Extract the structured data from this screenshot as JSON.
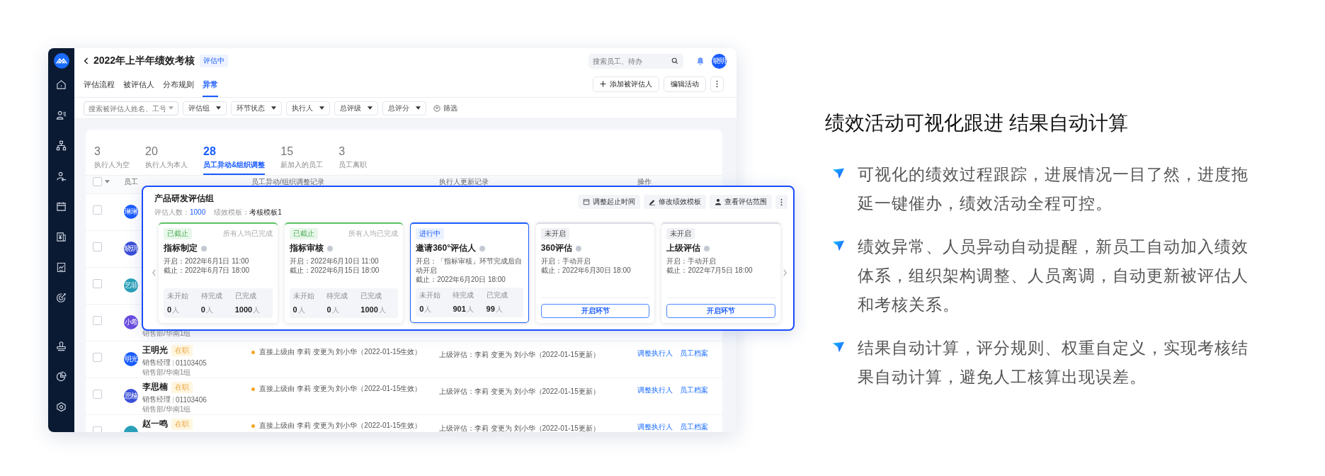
{
  "header": {
    "title": "2022年上半年绩效考核",
    "status": "评估中",
    "search": {
      "placeholder": "搜索员工、待办"
    },
    "avatar": "晓明"
  },
  "tabs": [
    {
      "label": "评估流程",
      "selected": false
    },
    {
      "label": "被评估人",
      "selected": false
    },
    {
      "label": "分布规则",
      "selected": false
    },
    {
      "label": "异常",
      "selected": true
    }
  ],
  "actions": [
    {
      "label": "添加被评估人",
      "kind": "add"
    },
    {
      "label": "编辑活动",
      "kind": "plain"
    }
  ],
  "filters": {
    "search": {
      "placeholder": "搜索被评估人姓名、工号"
    },
    "dropdowns": [
      "评估组",
      "环节状态",
      "执行人",
      "总评级",
      "总评分"
    ],
    "filter_button": "筛选"
  },
  "stats": [
    {
      "count": "3",
      "label": "执行人为空",
      "selected": false
    },
    {
      "count": "20",
      "label": "执行人为本人",
      "selected": false
    },
    {
      "count": "28",
      "label": "员工异动&组织调整",
      "selected": true
    },
    {
      "count": "15",
      "label": "新加入的员工",
      "selected": false
    },
    {
      "count": "3",
      "label": "员工离职",
      "selected": false
    }
  ],
  "table": {
    "select_all": {
      "checked": false
    },
    "columns": [
      "员工",
      "员工异动/组织调整记录",
      "执行人更新记录",
      "操作"
    ],
    "rows": [
      {
        "checked": false,
        "avatar": "琳琳",
        "color": "#1a5cff"
      },
      {
        "checked": false,
        "avatar": "晓玥",
        "color": "#3b4fd8"
      },
      {
        "checked": false,
        "avatar": "艺菲",
        "color": "#2aa0b8"
      },
      {
        "checked": false,
        "avatar": "小希",
        "color": "#6a4de0",
        "department": "销售部/华南1组"
      },
      {
        "checked": false,
        "avatar": "明光",
        "color": "#1a5cff",
        "name": "王明光",
        "status": "在职",
        "position": "销售经理",
        "employee_id": "01103405",
        "department": "销售部/华南1组",
        "change": "直接上级由 李莉 变更为 刘小华（2022-01-15生效）",
        "executor": "上级评估：李莉 变更为 刘小华（2022-01-15更新）",
        "actions": [
          "调整执行人",
          "员工档案"
        ]
      },
      {
        "checked": false,
        "avatar": "思楠",
        "color": "#3b4fd8",
        "name": "李思楠",
        "status": "在职",
        "position": "销售经理",
        "employee_id": "01103406",
        "department": "销售部/华南1组",
        "change": "直接上级由 李莉 变更为 刘小华（2022-01-15生效）",
        "executor": "上级评估：李莉 变更为 刘小华（2022-01-15更新）",
        "actions": [
          "调整执行人",
          "员工档案"
        ]
      },
      {
        "checked": false,
        "color": "#2aa0b8",
        "name": "赵一鸣",
        "status": "在职",
        "change": "直接上级由 李莉 变更为 刘小华（2022-01-15生效）",
        "executor": "上级评估：李莉 变更为 刘小华（2022-01-15更新）",
        "actions": [
          "调整执行人",
          "员工档案"
        ]
      }
    ]
  },
  "group": {
    "title": "产品研发评估组",
    "evaluator_label": "评估人数：",
    "evaluator_count": "1000",
    "template_label": "绩效模板：",
    "template": "考核模板1",
    "actions": [
      {
        "label": "调整起止时间",
        "kind": "calendar"
      },
      {
        "label": "修改绩效模板",
        "kind": "pencil"
      },
      {
        "label": "查看评估范围",
        "kind": "person"
      }
    ],
    "stages": [
      {
        "kind": "closed",
        "status": "已截止",
        "note": "所有人均已完成",
        "name": "指标制定",
        "start": "开启：2022年6月1日 11:00",
        "end": "截止：2022年6月7日 18:00",
        "counts": [
          {
            "label": "未开始",
            "value": "0",
            "unit": "人"
          },
          {
            "label": "待完成",
            "value": "0",
            "unit": "人"
          },
          {
            "label": "已完成",
            "value": "1000",
            "unit": "人"
          }
        ]
      },
      {
        "kind": "closed",
        "status": "已截止",
        "note": "所有人均已完成",
        "name": "指标审核",
        "start": "开启：2022年6月10日 11:00",
        "end": "截止：2022年6月15日 18:00",
        "counts": [
          {
            "label": "未开始",
            "value": "0",
            "unit": "人"
          },
          {
            "label": "待完成",
            "value": "0",
            "unit": "人"
          },
          {
            "label": "已完成",
            "value": "1000",
            "unit": "人"
          }
        ]
      },
      {
        "kind": "active",
        "status": "进行中",
        "name": "邀请360°评估人",
        "start": "开启：「指标审核」环节完成后自动开启",
        "end": "截止：2022年6月20日 18:00",
        "counts": [
          {
            "label": "未开始",
            "value": "0",
            "unit": "人"
          },
          {
            "label": "待完成",
            "value": "901",
            "unit": "人"
          },
          {
            "label": "已完成",
            "value": "99",
            "unit": "人"
          }
        ]
      },
      {
        "kind": "pending",
        "status": "未开启",
        "name": "360评估",
        "start": "开启：手动开启",
        "end": "截止：2022年6月30日 18:00",
        "button": "开启环节"
      },
      {
        "kind": "pending",
        "status": "未开启",
        "name": "上级评估",
        "start": "开启：手动开启",
        "end": "截止：2022年7月5日 18:00",
        "button": "开启环节"
      }
    ]
  },
  "feature": {
    "title": "绩效活动可视化跟进 结果自动计算",
    "bullets": [
      "可视化的绩效过程跟踪，进展情况一目了然，进度拖延一键催办，绩效活动全程可控。",
      "绩效异常、人员异动自动提醒，新员工自动加入绩效体系，组织架构调整、人员离调，自动更新被评估人和考核关系。",
      "结果自动计算，评分规则、权重自定义，实现考核结果自动计算，避免人工核算出现误差。"
    ]
  }
}
